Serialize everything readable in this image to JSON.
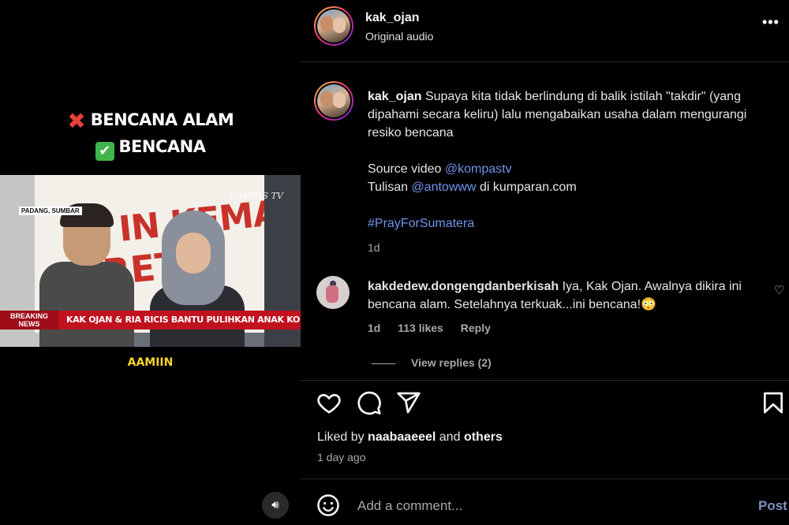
{
  "video": {
    "caption_line1": "BENCANA ALAM",
    "caption_line2": "BENCANA",
    "location_tag": "PADANG, SUMBAR",
    "channel_watermark": "KOMPAS TV",
    "banner_text_1": "IN KEMANUS",
    "banner_text_2": "RET",
    "breaking_label_1": "BREAKING",
    "breaking_label_2": "NEWS",
    "ticker_text": "KAK OJAN & RIA RICIS BANTU PULIHKAN ANAK KORBAN BENCANA",
    "subtitle": "AAMIIN",
    "audio_icon": "speaker-icon"
  },
  "header": {
    "username": "kak_ojan",
    "subtitle": "Original audio",
    "more_icon": "more-icon"
  },
  "post": {
    "username": "kak_ojan",
    "caption": "Supaya kita tidak berlindung di balik istilah \"takdir\" (yang dipahami secara keliru) lalu mengabaikan usaha dalam mengurangi resiko bencana",
    "source_label": "Source video",
    "source_mention": "@kompastv",
    "tulisan_label": "Tulisan",
    "tulisan_mention": "@antowww",
    "tulisan_suffix": "di kumparan.com",
    "hashtag": "#PrayForSumatera",
    "age": "1d"
  },
  "comment": {
    "username": "kakdedew.dongengdanberkisah",
    "text": "Iya, Kak Ojan. Awalnya dikira ini bencana alam. Setelahnya terkuak...ini bencana!😳",
    "age": "1d",
    "likes": "113 likes",
    "reply_label": "Reply",
    "view_replies": "View replies (2)"
  },
  "actions": {
    "like_icon": "heart-icon",
    "comment_icon": "comment-icon",
    "share_icon": "share-icon",
    "save_icon": "bookmark-icon"
  },
  "likes": {
    "prefix": "Liked by",
    "user": "naabaaeeel",
    "joiner": "and",
    "others": "others",
    "date": "1 day ago"
  },
  "composer": {
    "placeholder": "Add a comment...",
    "post_label": "Post"
  },
  "colors": {
    "background": "#000000",
    "link": "#6f95ea",
    "muted_text": "#a8a8a8",
    "ticker_red": "#c1121f",
    "subtitle_yellow": "#f5d42a"
  }
}
